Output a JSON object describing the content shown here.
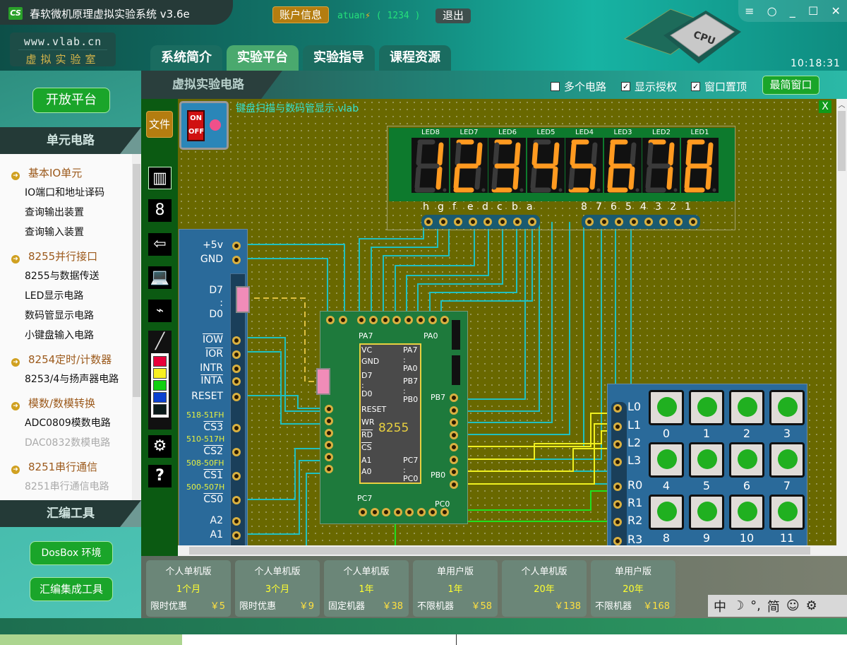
{
  "app": {
    "title": "春软微机原理虚拟实验系统 v3.6e",
    "logo": "CS",
    "site_url": "www.vlab.cn",
    "site_name": "虚拟实验室",
    "account_btn": "账户信息",
    "user": "atuan",
    "user_id": "( 1234 )",
    "logout": "退出",
    "clock": "10:18:31",
    "cpu_label": "CPU"
  },
  "window_controls": [
    "menu-icon",
    "circle-icon",
    "minimize-icon",
    "maximize-icon",
    "close-icon"
  ],
  "tabs": [
    {
      "label": "系统简介"
    },
    {
      "label": "实验平台",
      "active": true
    },
    {
      "label": "实验指导"
    },
    {
      "label": "课程资源"
    }
  ],
  "sidebar": {
    "open_platform": "开放平台",
    "units_title": "单元电路",
    "groups": [
      {
        "title": "基本IO单元",
        "items": [
          "IO端口和地址译码",
          "查询输出装置",
          "查询输入装置"
        ]
      },
      {
        "title": "8255并行接口",
        "items": [
          "8255与数据传送",
          "LED显示电路",
          "数码管显示电路",
          "小键盘输入电路"
        ]
      },
      {
        "title": "8254定时/计数器",
        "items": [
          "8253/4与扬声器电路"
        ]
      },
      {
        "title": "模数/数模转换",
        "items": [
          "ADC0809模数电路",
          "DAC0832数模电路"
        ]
      },
      {
        "title": "8251串行通信",
        "items": [
          "8251串行通信电路"
        ]
      }
    ],
    "asm_title": "汇编工具",
    "dosbox": "DosBox 环境",
    "asm_ide": "汇编集成工具"
  },
  "main": {
    "title": "虚拟实验电路",
    "options": [
      {
        "label": "多个电路",
        "checked": false
      },
      {
        "label": "显示授权",
        "checked": true
      },
      {
        "label": "窗口置顶",
        "checked": true
      }
    ],
    "min_window": "最简窗口",
    "file_btn": "文件",
    "file_name": "键盘扫描与数码管显示.vlab",
    "close": "X"
  },
  "toolbar": [
    "chip-icon",
    "seven-segment-icon",
    "input-icon",
    "laptop-icon",
    "oscilloscope-icon",
    "line-icon",
    "color-red",
    "color-yellow",
    "color-green",
    "color-blue",
    "color-black",
    "gear-icon",
    "help-icon"
  ],
  "colors": {
    "red": "#e8003a",
    "yellow": "#f8f020",
    "green": "#10d010",
    "blue": "#0a40d0",
    "black": "#0a1a1a",
    "wire": "#20c0c0"
  },
  "circuit": {
    "switch": {
      "on": "ON",
      "off": "OFF"
    },
    "display": {
      "leds": [
        "LED8",
        "LED7",
        "LED6",
        "LED5",
        "LED4",
        "LED3",
        "LED2",
        "LED1"
      ],
      "digits": [
        "1",
        "2",
        "3",
        "4",
        "5",
        "6",
        "7",
        "8"
      ],
      "seg_pins": [
        "h",
        "g",
        "f",
        "e",
        "d",
        "c",
        "b",
        "a"
      ],
      "digit_pins": [
        "8",
        "7",
        "6",
        "5",
        "4",
        "3",
        "2",
        "1"
      ]
    },
    "bus": {
      "pins": [
        "+5v",
        "GND",
        "D7",
        ":",
        "D0",
        "IOW",
        "IOR",
        "INTR",
        "INTA",
        "RESET",
        "CS3",
        "CS2",
        "CS1",
        "CS0",
        "A2",
        "A1"
      ],
      "addrs": [
        "518-51FH",
        "510-517H",
        "508-50FH",
        "500-507H"
      ]
    },
    "chip": {
      "name": "8255",
      "left": [
        "VC",
        "GND",
        "D7",
        ":",
        "D0",
        "RESET",
        "WR",
        "RD",
        "CS",
        "A1",
        "A0"
      ],
      "right": [
        "PA7",
        ":",
        "PA0",
        "PB7",
        ":",
        "PB0",
        "PC7",
        ":",
        "PC0"
      ],
      "board": [
        "PA7",
        "PA0",
        "PB7",
        "PB0",
        "PC7",
        "PC0"
      ]
    },
    "keypad": {
      "rows": [
        "L0",
        "L1",
        "L2",
        "L3",
        "R0",
        "R1",
        "R2",
        "R3"
      ],
      "keys": [
        "0",
        "1",
        "2",
        "3",
        "4",
        "5",
        "6",
        "7",
        "8",
        "9",
        "10",
        "11"
      ]
    }
  },
  "pricing": [
    {
      "type": "个人单机版",
      "duration": "1个月",
      "note": "限时优惠",
      "price": "￥5"
    },
    {
      "type": "个人单机版",
      "duration": "3个月",
      "note": "限时优惠",
      "price": "￥9"
    },
    {
      "type": "个人单机版",
      "duration": "1年",
      "note": "固定机器",
      "price": "￥38"
    },
    {
      "type": "单用户版",
      "duration": "1年",
      "note": "不限机器",
      "price": "￥58"
    },
    {
      "type": "个人单机版",
      "duration": "20年",
      "note": "",
      "price": "￥138"
    },
    {
      "type": "单用户版",
      "duration": "20年",
      "note": "不限机器",
      "price": "￥168"
    }
  ],
  "ime": [
    "中",
    "☽",
    "°,",
    "简",
    "☺",
    "⚙"
  ]
}
